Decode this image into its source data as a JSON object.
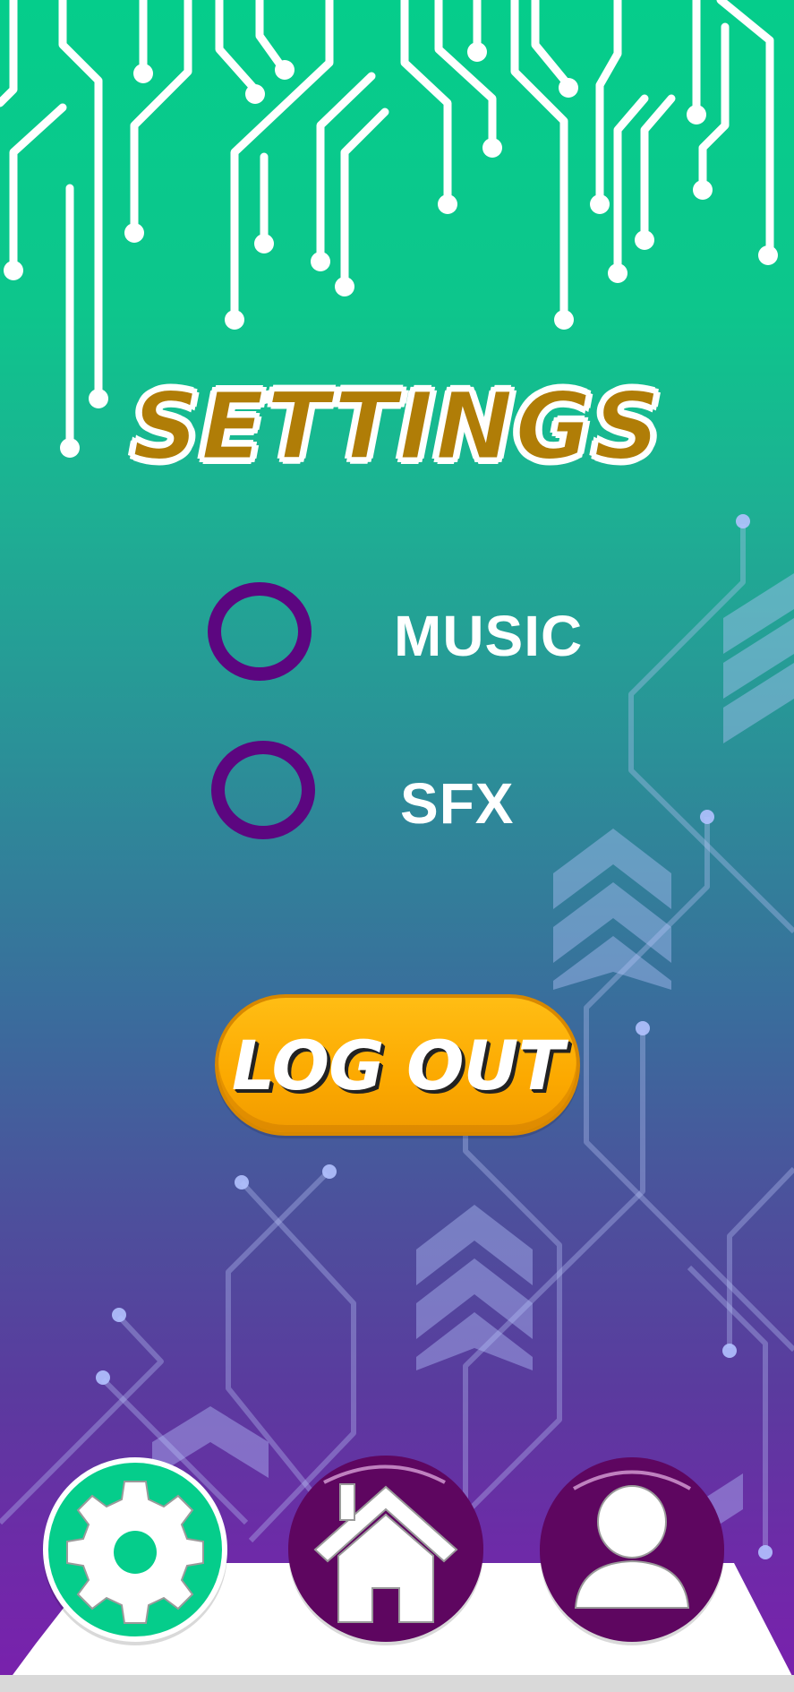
{
  "screen": {
    "title": "SETTINGS",
    "options": [
      {
        "label": "MUSIC",
        "enabled": false
      },
      {
        "label": "SFX",
        "enabled": false
      }
    ],
    "logout_label": "LOG OUT"
  },
  "bottom_nav": {
    "items": [
      {
        "icon": "gear-icon",
        "active": true
      },
      {
        "icon": "home-icon",
        "active": false
      },
      {
        "icon": "user-icon",
        "active": false
      }
    ]
  },
  "colors": {
    "accent_green": "#05cd8b",
    "toggle_purple": "#5c0680",
    "title_gold": "#b07d07",
    "logout_orange": "#fca900",
    "nav_purple": "#5e0660"
  }
}
